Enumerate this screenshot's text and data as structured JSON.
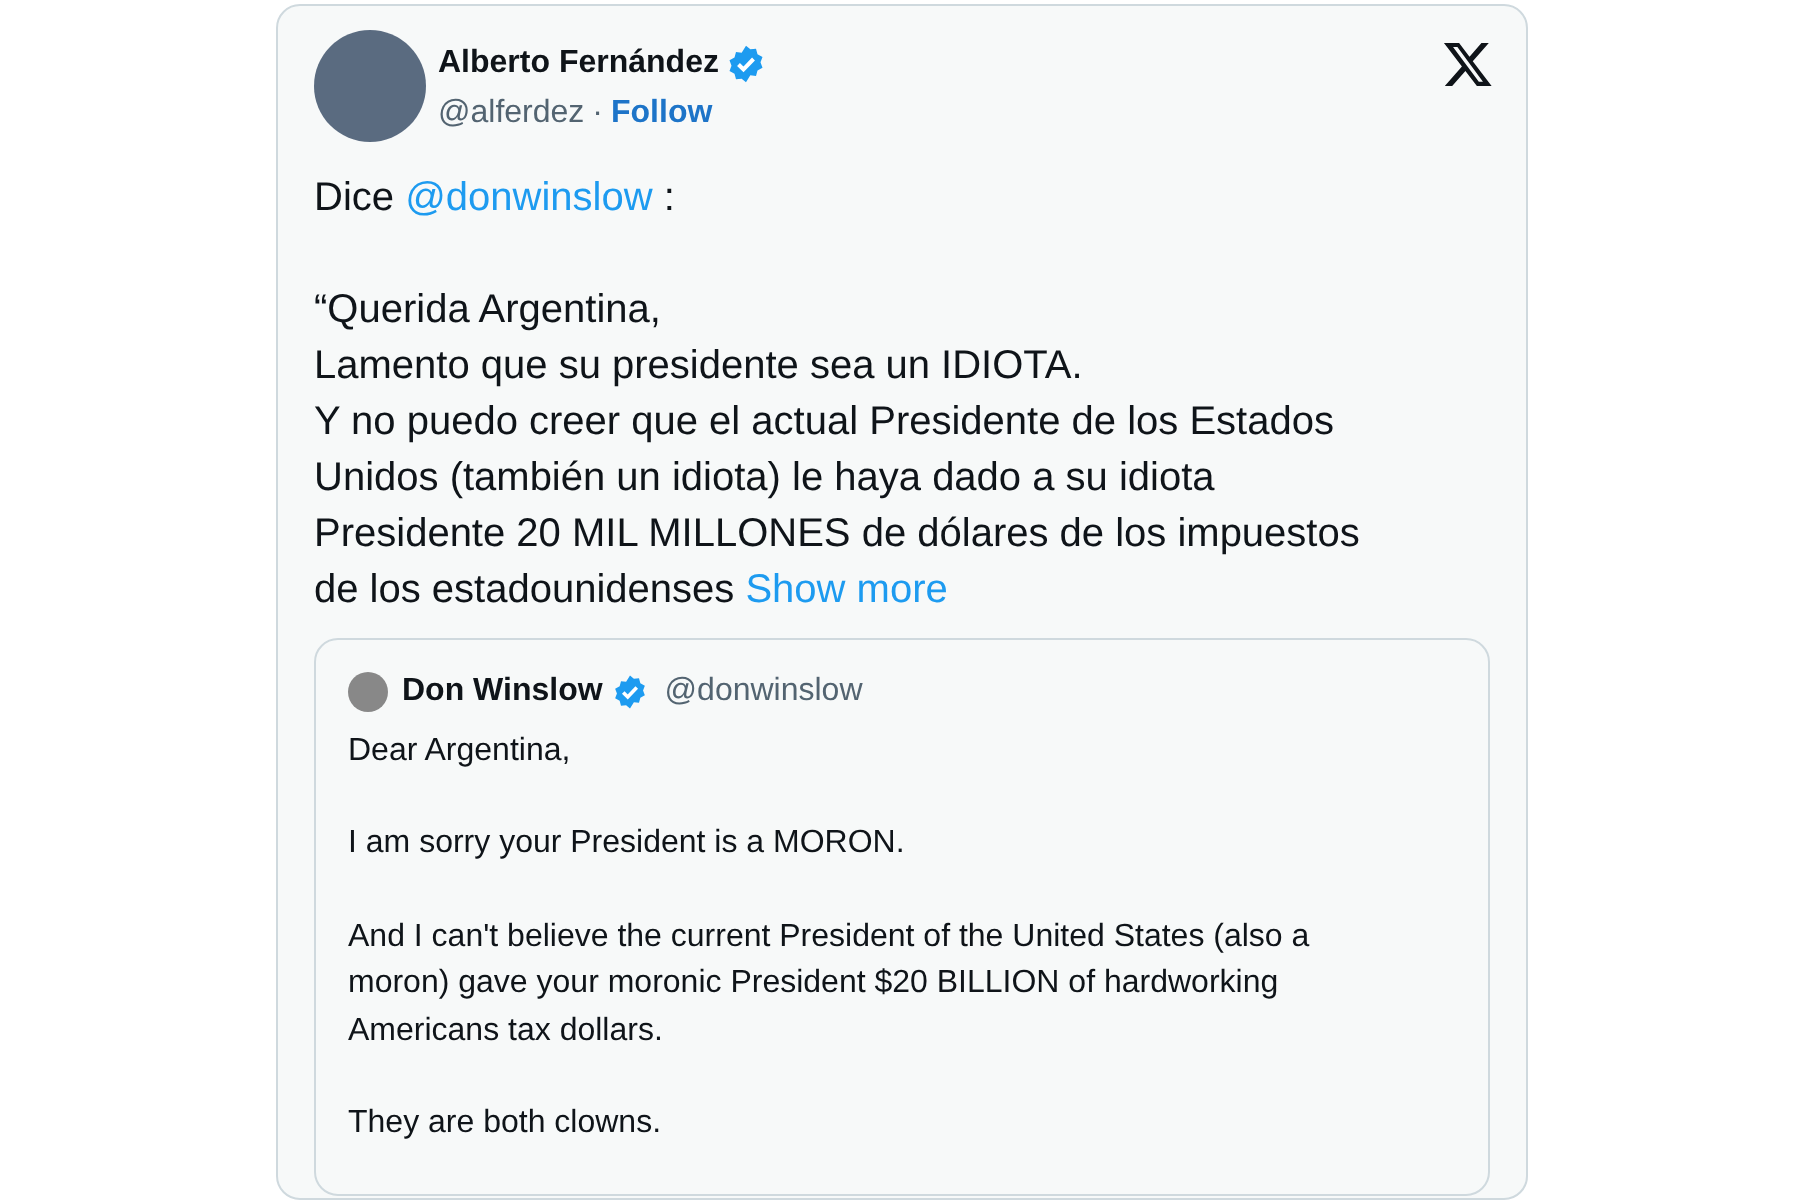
{
  "tweet": {
    "author": {
      "name": "Alberto Fernández",
      "verified": true,
      "handle": "@alferdez",
      "separator": "·",
      "follow": "Follow"
    },
    "body": [
      [
        [
          {
            "text": "Dice "
          },
          {
            "text": "@donwinslow",
            "kind": "link"
          },
          {
            "text": " :"
          }
        ]
      ],
      [
        [
          {
            "text": "“Querida Argentina,"
          }
        ],
        [
          {
            "text": "Lamento que su presidente sea un IDIOTA."
          }
        ],
        [
          {
            "text": "Y no puedo creer que el actual Presidente de los Estados"
          }
        ],
        [
          {
            "text": "Unidos (también un idiota) le haya dado a su idiota"
          }
        ],
        [
          {
            "text": "Presidente 20 MIL MILLONES de dólares de los impuestos"
          }
        ],
        [
          {
            "text": "de los estadounidenses "
          },
          {
            "text": "Show more",
            "kind": "link"
          }
        ]
      ]
    ],
    "quote": {
      "author": {
        "name": "Don Winslow",
        "verified": true,
        "handle": "@donwinslow"
      },
      "paragraphs": [
        [
          "Dear Argentina,"
        ],
        [
          "I am sorry your President is a MORON."
        ],
        [
          "And I  can't believe the current President of the United States (also a",
          "moron) gave your moronic President $20 BILLION of hardworking",
          "Americans tax dollars."
        ],
        [
          "They are both clowns."
        ]
      ]
    }
  }
}
